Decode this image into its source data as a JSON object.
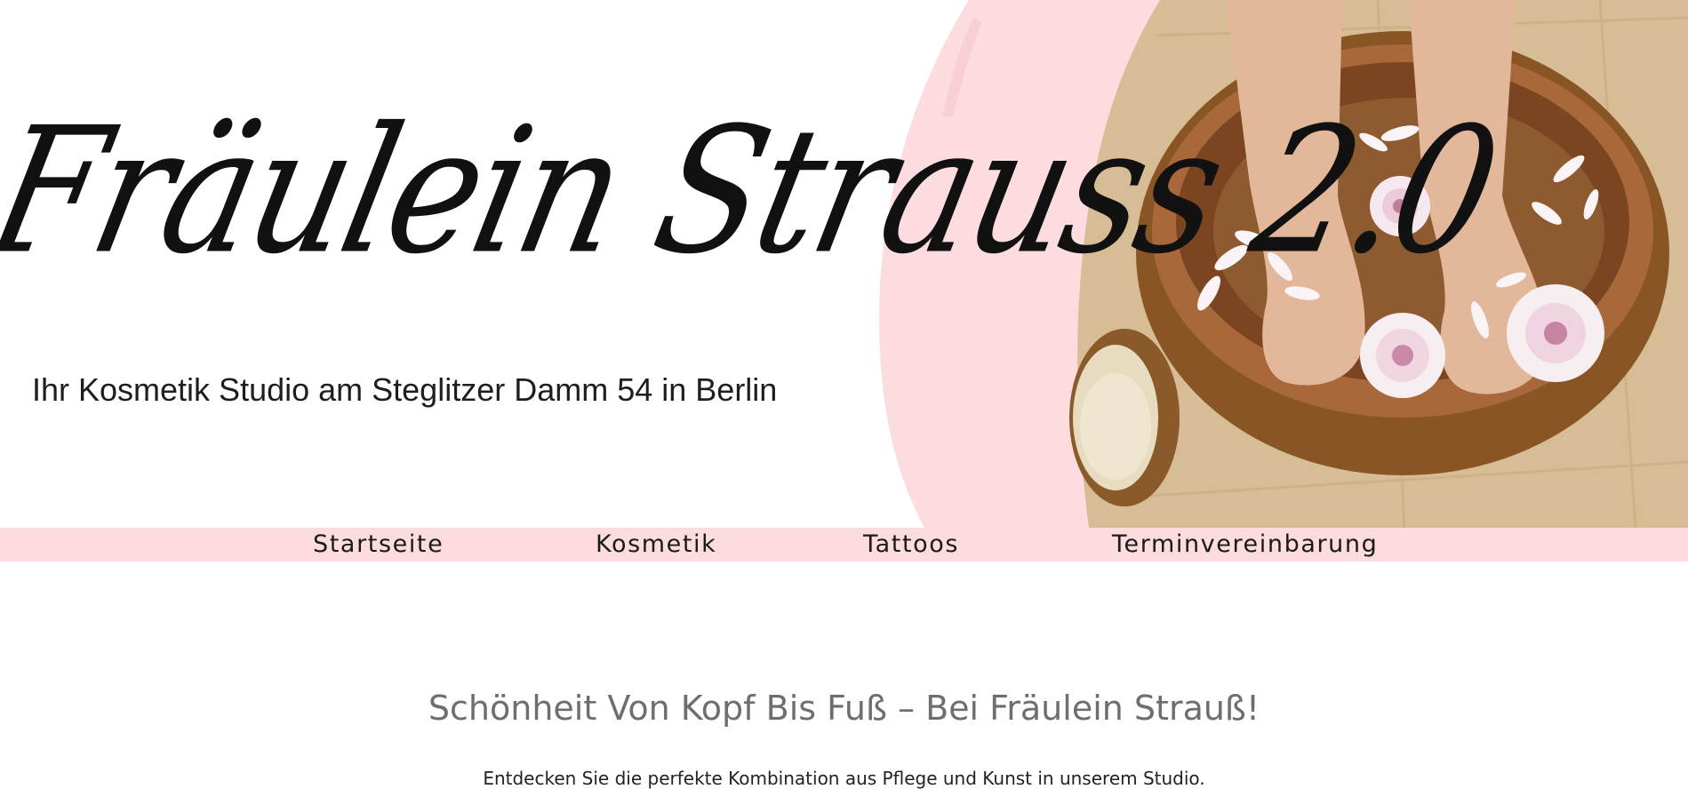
{
  "hero": {
    "title": "Fräulein Strauss 2.0",
    "subtitle": "Ihr Kosmetik Studio am Steglitzer Damm 54 in Berlin",
    "image": "foot-bath-with-flowers-photo"
  },
  "nav": {
    "items": [
      {
        "label": "Startseite"
      },
      {
        "label": "Kosmetik"
      },
      {
        "label": "Tattoos"
      },
      {
        "label": "Terminvereinbarung"
      }
    ]
  },
  "main": {
    "heading": "Schönheit Von Kopf Bis Fuß – Bei Fräulein Strauß!",
    "intro": "Entdecken Sie die perfekte Kombination aus Pflege und Kunst in unserem Studio."
  },
  "colors": {
    "accent_pink": "#fddcdf",
    "heading_gray": "#6e6e6e",
    "text_dark": "#1a1a1a"
  }
}
